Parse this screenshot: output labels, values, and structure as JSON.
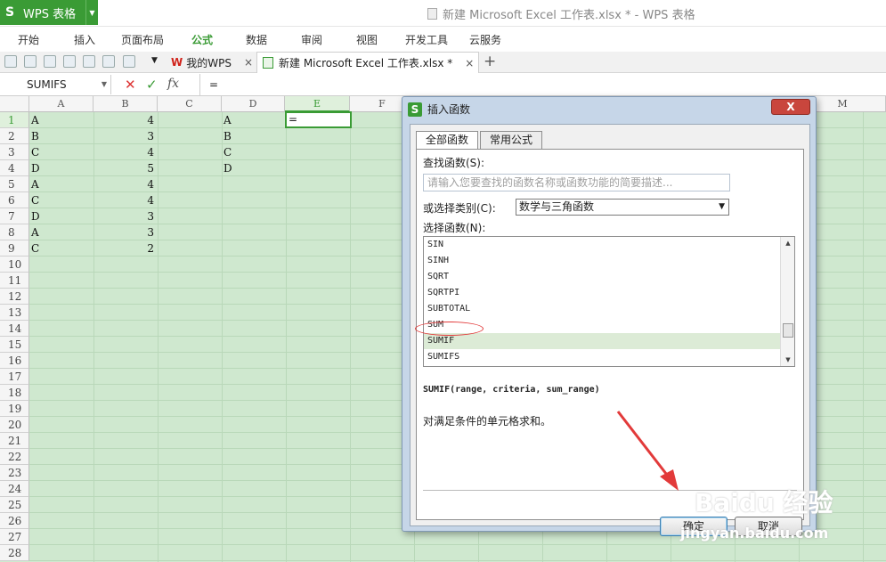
{
  "titlebar": {
    "app_name": "WPS 表格",
    "window_title": "新建 Microsoft Excel 工作表.xlsx * - WPS 表格"
  },
  "menu": [
    "开始",
    "插入",
    "页面布局",
    "公式",
    "数据",
    "审阅",
    "视图",
    "开发工具",
    "云服务"
  ],
  "menu_active_index": 3,
  "tabs": {
    "my_wps": "我的WPS",
    "doc": "新建 Microsoft Excel 工作表.xlsx *",
    "close": "×",
    "add": "+"
  },
  "formula_bar": {
    "name_box": "SUMIFS",
    "fx": "fx",
    "value": "="
  },
  "columns": [
    "A",
    "B",
    "C",
    "D",
    "E",
    "F",
    "M"
  ],
  "rows": [
    "1",
    "2",
    "3",
    "4",
    "5",
    "6",
    "7",
    "8",
    "9",
    "10",
    "11",
    "12",
    "13",
    "14",
    "15",
    "16",
    "17",
    "18",
    "19",
    "20",
    "21",
    "22",
    "23",
    "24",
    "25",
    "26",
    "27",
    "28"
  ],
  "cells": {
    "colA": [
      "A",
      "B",
      "C",
      "D",
      "A",
      "C",
      "D",
      "A",
      "C"
    ],
    "colB": [
      "4",
      "3",
      "4",
      "5",
      "4",
      "4",
      "3",
      "3",
      "2"
    ],
    "colD": [
      "A",
      "B",
      "C",
      "D"
    ],
    "E1": "="
  },
  "dialog": {
    "title": "插入函数",
    "close": "X",
    "tab_all": "全部函数",
    "tab_common": "常用公式",
    "search_label": "查找函数(S):",
    "search_placeholder": "请输入您要查找的函数名称或函数功能的简要描述...",
    "category_label": "或选择类别(C):",
    "category_value": "数学与三角函数",
    "function_label": "选择函数(N):",
    "functions": [
      "SIN",
      "SINH",
      "SQRT",
      "SQRTPI",
      "SUBTOTAL",
      "SUM",
      "SUMIF",
      "SUMIFS"
    ],
    "selected_function": "SUMIF",
    "syntax": "SUMIF(range, criteria, sum_range)",
    "description": "对满足条件的单元格求和。",
    "ok": "确定",
    "cancel": "取消"
  },
  "watermark": {
    "brand": "Baidu 经验",
    "url": "jingyan.baidu.com"
  },
  "colors": {
    "accent": "#3a9b35",
    "grid_bg": "#cfe8cf",
    "annotation_red": "#e23a3a"
  }
}
